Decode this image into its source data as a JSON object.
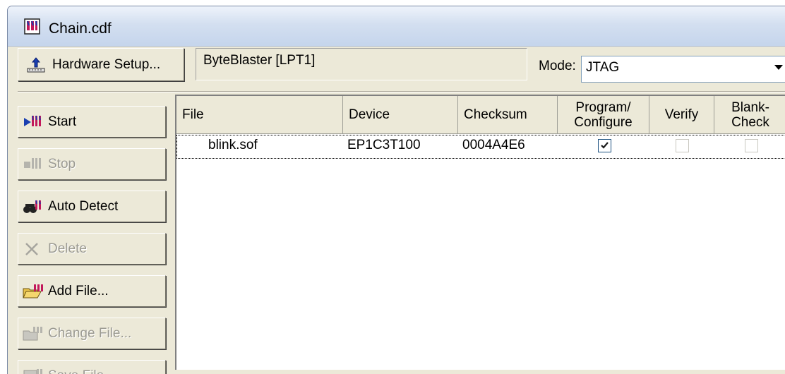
{
  "window": {
    "title": "Chain.cdf"
  },
  "toolbar": {
    "hardware_setup_label": "Hardware Setup...",
    "hardware_value": "ByteBlaster [LPT1]",
    "mode_label": "Mode:",
    "mode_value": "JTAG"
  },
  "sidebar": {
    "start": "Start",
    "stop": "Stop",
    "auto_detect": "Auto Detect",
    "delete": "Delete",
    "add_file": "Add File...",
    "change_file": "Change File...",
    "save_file": "Save File"
  },
  "table": {
    "columns": {
      "file": "File",
      "device": "Device",
      "checksum": "Checksum",
      "program_1": "Program/",
      "program_2": "Configure",
      "verify": "Verify",
      "blank_1": "Blank-",
      "blank_2": "Check"
    },
    "rows": [
      {
        "file": "blink.sof",
        "device": "EP1C3T100",
        "checksum": "0004A4E6",
        "program": true,
        "verify": false,
        "blank_check": false
      }
    ]
  },
  "colors": {
    "face": "#ece9d8",
    "title_gradient": "#d3dff0",
    "disabled_text": "#9b9a92"
  }
}
